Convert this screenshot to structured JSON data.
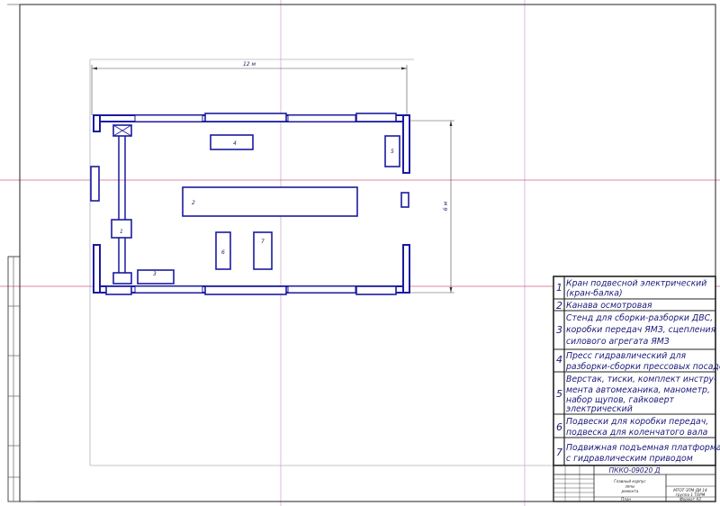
{
  "drawing": {
    "dimension_width": "12 м",
    "dimension_height": "6 м",
    "equipment_labels": [
      "1",
      "2",
      "3",
      "4",
      "5",
      "6",
      "7"
    ]
  },
  "legend": [
    {
      "num": "1",
      "lines": [
        "Кран подвесной электрический",
        "(кран-балка)"
      ]
    },
    {
      "num": "2",
      "lines": [
        "Канава осмотровая"
      ]
    },
    {
      "num": "3",
      "lines": [
        "Стенд для сборки-разборки ДВС,",
        "коробки передач ЯМЗ, сцепления",
        "силового агрегата ЯМЗ"
      ]
    },
    {
      "num": "4",
      "lines": [
        "Пресс гидравлический для",
        "разборки-сборки прессовых посадок"
      ]
    },
    {
      "num": "5",
      "lines": [
        "Верстак, тиски, комплект инстру-",
        "мента автомеханика, манометр,",
        "набор щупов, гайковерт",
        "электрический"
      ]
    },
    {
      "num": "6",
      "lines": [
        "Подвески для коробки передач,",
        "подвеска для коленчатого вала"
      ]
    },
    {
      "num": "7",
      "lines": [
        "Подвижная подъемная платформа",
        "с гидравлическим приводом"
      ]
    }
  ],
  "title_block": {
    "doc_code": "ПККО-09020 Д",
    "title_lines": [
      "Главный корпус",
      "зоны",
      "ремонта"
    ],
    "scale_note": "План",
    "group": "МТОТ-ЗПМ ДИ 14",
    "group2": "группа 1 ТОРМ",
    "sheet": "Формат А3"
  }
}
